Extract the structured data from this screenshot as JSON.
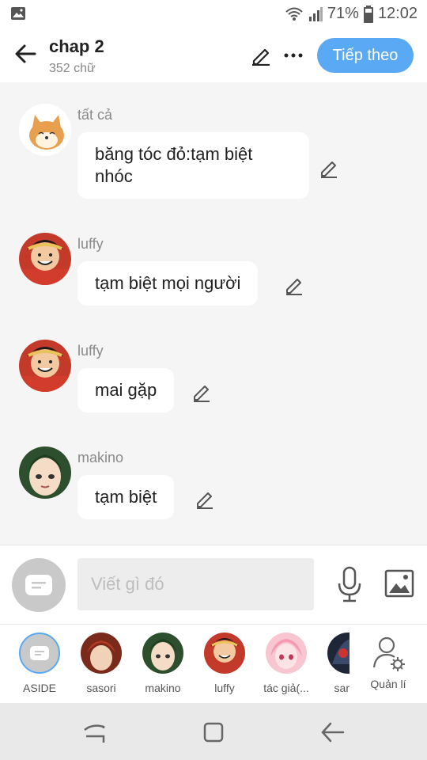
{
  "status_bar": {
    "battery": "71%",
    "time": "12:02"
  },
  "header": {
    "title": "chap 2",
    "subtitle": "352 chữ",
    "next_label": "Tiếp theo"
  },
  "messages": [
    {
      "sender": "tất cả",
      "text": "băng tóc đỏ:tạm biệt nhóc",
      "avatar": "shiba-avatar"
    },
    {
      "sender": "luffy",
      "text": "tạm biệt mọi người",
      "avatar": "luffy-avatar"
    },
    {
      "sender": "luffy",
      "text": "mai gặp",
      "avatar": "luffy-avatar"
    },
    {
      "sender": "makino",
      "text": "tạm biệt",
      "avatar": "makino-avatar"
    }
  ],
  "composer": {
    "placeholder": "Viết gì đó"
  },
  "characters": [
    {
      "name": "ASIDE"
    },
    {
      "name": "sasori"
    },
    {
      "name": "makino"
    },
    {
      "name": "luffy"
    },
    {
      "name": "tác giả(..."
    },
    {
      "name": "sar"
    },
    {
      "name": "Quản lí"
    }
  ],
  "colors": {
    "accent": "#5aa9f5",
    "background": "#f5f5f5",
    "bubble": "#ffffff"
  }
}
